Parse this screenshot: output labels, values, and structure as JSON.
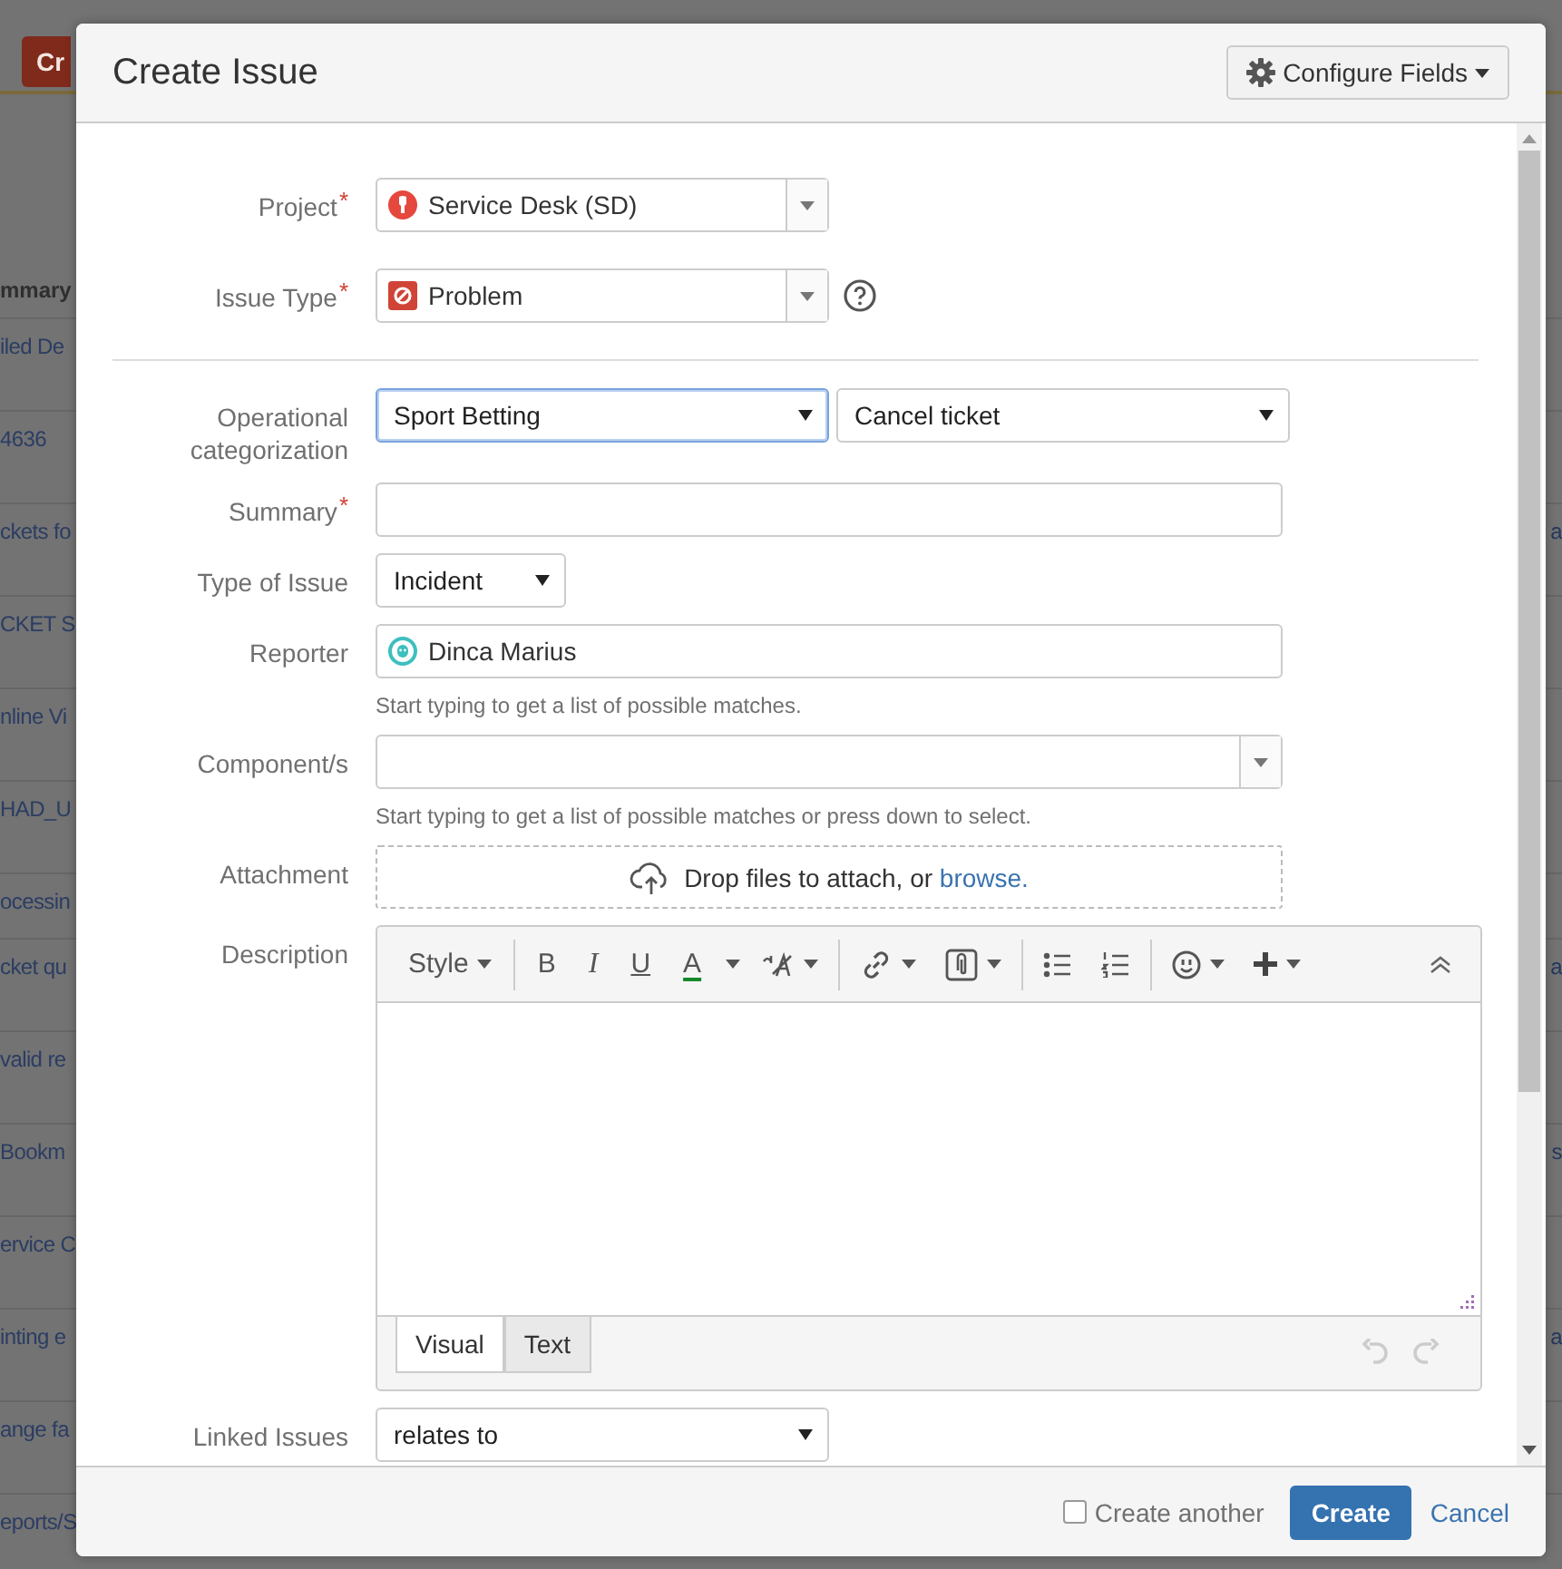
{
  "backdrop": {
    "create_button": "Cr",
    "column_header": "mmary",
    "rows": [
      {
        "summary": "iled De"
      },
      {
        "summary": "4636"
      },
      {
        "summary": "ckets fo",
        "column_2": "a"
      },
      {
        "summary": "CKET S"
      },
      {
        "summary": "nline Vi"
      },
      {
        "summary": "HAD_U"
      },
      {
        "summary": "ocessin"
      },
      {
        "summary": "cket qu",
        "column_2": "a"
      },
      {
        "summary": "valid re"
      },
      {
        "summary": "Bookm",
        "column_2": "s"
      },
      {
        "summary": "ervice C"
      },
      {
        "summary": "inting e",
        "column_2": "a"
      },
      {
        "summary": "ange fa"
      },
      {
        "summary": "eports/S"
      }
    ]
  },
  "dialog": {
    "title": "Create Issue",
    "configure_button": "Configure Fields",
    "fields": [
      {
        "kind": "picker",
        "label": "Project",
        "required_mark": "*",
        "value": "Service Desk (SD)"
      },
      {
        "kind": "picker",
        "label": "Issue Type",
        "required_mark": "*",
        "value": "Problem",
        "help": true
      },
      {
        "kind": "select_pair",
        "label": "Operational categorization",
        "selects": [
          {
            "value": "Sport Betting",
            "focused": true
          },
          {
            "value": "Cancel ticket",
            "focused": false
          }
        ]
      },
      {
        "kind": "text",
        "label": "Summary",
        "required_mark": "*"
      },
      {
        "kind": "select",
        "label": "Type of Issue",
        "value": "Incident"
      },
      {
        "kind": "user",
        "label": "Reporter",
        "value": "Dinca Marius",
        "hint": "Start typing to get a list of possible matches."
      },
      {
        "kind": "picker",
        "label": "Component/s",
        "hint": "Start typing to get a list of possible matches or press down to select."
      },
      {
        "kind": "dropzone",
        "label": "Attachment",
        "text": "Drop files to attach, or",
        "link": "browse."
      },
      {
        "kind": "editor",
        "label": "Description",
        "style_menu": "Style",
        "format_buttons": [
          {
            "kind": "bold",
            "text": "B"
          },
          {
            "kind": "italic",
            "text": "I"
          },
          {
            "kind": "underline",
            "text": "U"
          },
          {
            "kind": "color",
            "text": "A"
          }
        ],
        "tabs": [
          {
            "label": "Visual",
            "selected": true
          },
          {
            "label": "Text",
            "selected": false
          }
        ]
      },
      {
        "kind": "select",
        "label": "Linked Issues",
        "value": "relates to"
      }
    ],
    "footer": {
      "create_another": {
        "label": "Create another",
        "checked": false
      },
      "create_button": "Create",
      "cancel_link": "Cancel"
    }
  }
}
